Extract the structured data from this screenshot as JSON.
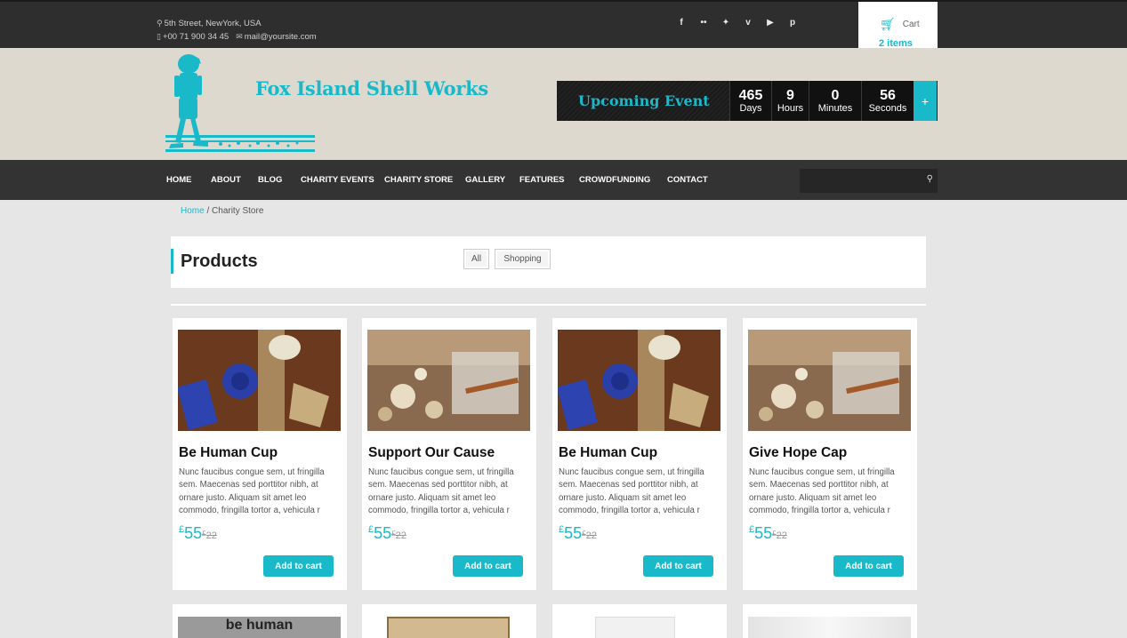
{
  "topbar": {
    "address": "5th Street, NewYork, USA",
    "phone": "+00 71 900 34 45",
    "email": "mail@yoursite.com",
    "social": [
      {
        "icon": "facebook-icon",
        "glyph": "f"
      },
      {
        "icon": "flickr-icon",
        "glyph": "••"
      },
      {
        "icon": "twitter-icon",
        "glyph": "✦"
      },
      {
        "icon": "vimeo-icon",
        "glyph": "v"
      },
      {
        "icon": "youtube-icon",
        "glyph": "▶"
      },
      {
        "icon": "pinterest-icon",
        "glyph": "p"
      }
    ],
    "cart_label": "Cart",
    "cart_items": "2  items"
  },
  "header": {
    "site_title": "Fox Island Shell Works",
    "event_title": "Upcoming Event",
    "countdown": [
      {
        "num": "465",
        "label": "Days"
      },
      {
        "num": "9",
        "label": "Hours"
      },
      {
        "num": "0",
        "label": "Minutes"
      },
      {
        "num": "56",
        "label": "Seconds"
      }
    ],
    "plus": "+"
  },
  "nav": {
    "items": [
      "HOME",
      "ABOUT",
      "BLOG",
      "CHARITY EVENTS",
      "CHARITY STORE",
      "GALLERY",
      "FEATURES",
      "CROWDFUNDING",
      "CONTACT"
    ]
  },
  "breadcrumb": {
    "home": "Home",
    "sep": " / ",
    "current": "Charity Store"
  },
  "products": {
    "title": "Products",
    "filters": [
      "All",
      "Shopping"
    ]
  },
  "cards": [
    {
      "name": "Be Human Cup",
      "desc": "Nunc faucibus congue sem, ut fringilla sem. Maecenas sed porttitor nibh, at ornare justo. Aliquam sit amet leo commodo, fringilla tortor a, vehicula r",
      "currency": "£",
      "price": "55",
      "old_currency": "£",
      "old_price": "22",
      "button": "Add to cart",
      "image": "ribbon"
    },
    {
      "name": "Support Our Cause",
      "desc": "Nunc faucibus congue sem, ut fringilla sem. Maecenas sed porttitor nibh, at ornare justo. Aliquam sit amet leo commodo, fringilla tortor a, vehicula r",
      "currency": "£",
      "price": "55",
      "old_currency": "£",
      "old_price": "22",
      "button": "Add to cart",
      "image": "shells"
    },
    {
      "name": "Be Human Cup",
      "desc": "Nunc faucibus congue sem, ut fringilla sem. Maecenas sed porttitor nibh, at ornare justo. Aliquam sit amet leo commodo, fringilla tortor a, vehicula r",
      "currency": "£",
      "price": "55",
      "old_currency": "£",
      "old_price": "22",
      "button": "Add to cart",
      "image": "ribbon"
    },
    {
      "name": "Give Hope Cap",
      "desc": "Nunc faucibus congue sem, ut fringilla sem. Maecenas sed porttitor nibh, at ornare justo. Aliquam sit amet leo commodo, fringilla tortor a, vehicula r",
      "currency": "£",
      "price": "55",
      "old_currency": "£",
      "old_price": "22",
      "button": "Add to cart",
      "image": "shells"
    }
  ],
  "second_row": [
    {
      "thumb_text": "be human"
    },
    {
      "thumb_text": ""
    },
    {
      "thumb_text": ""
    },
    {
      "thumb_text": ""
    }
  ],
  "colors": {
    "accent": "#1ab9c9",
    "topbar": "#2e2e2e",
    "nav": "#333333",
    "header_bg": "#ddd9cf"
  }
}
